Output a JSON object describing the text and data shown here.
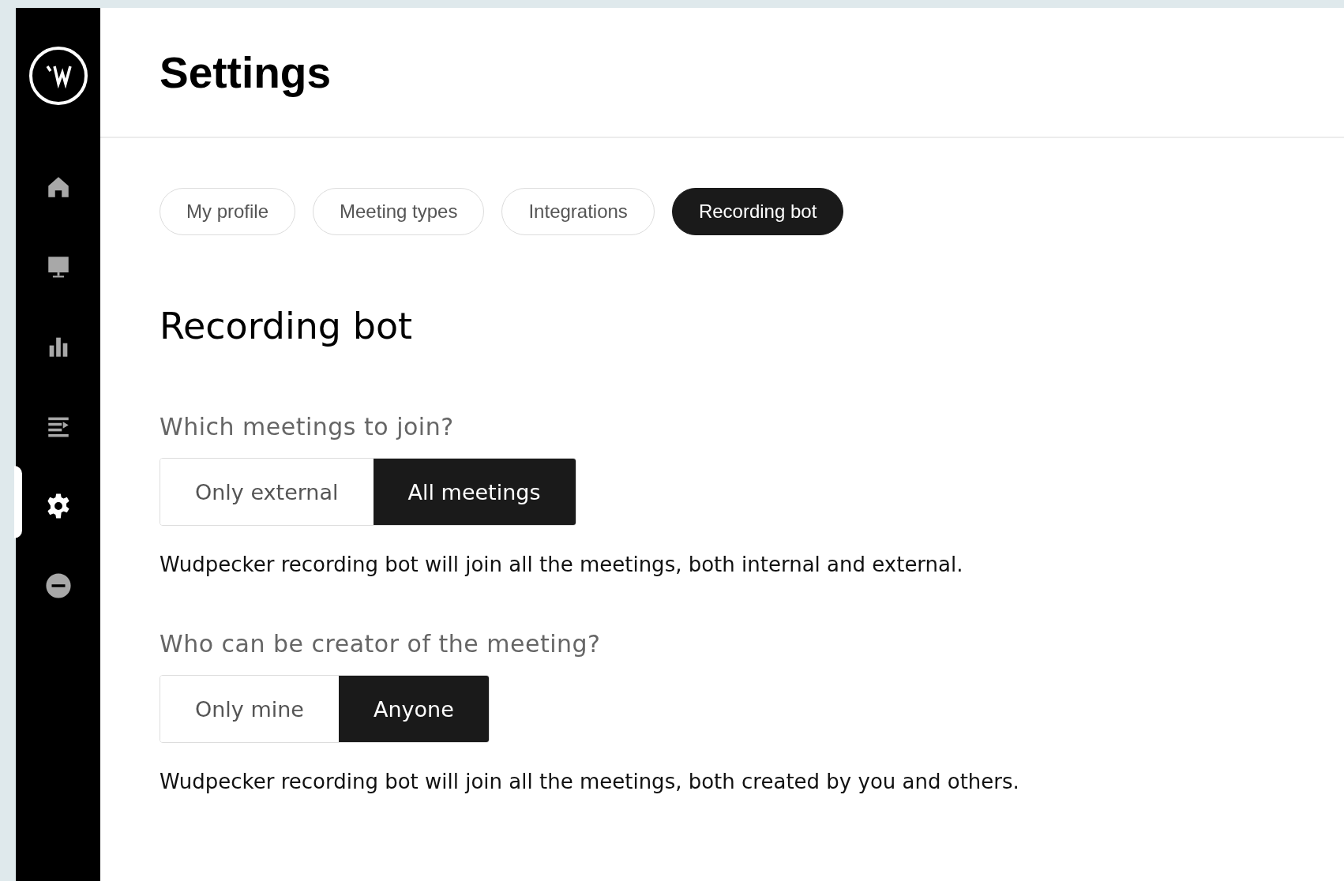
{
  "sidebar": {
    "items": [
      {
        "kind": "home",
        "selected": false
      },
      {
        "kind": "monitor",
        "selected": false
      },
      {
        "kind": "chart",
        "selected": false
      },
      {
        "kind": "list",
        "selected": false
      },
      {
        "kind": "settings",
        "selected": true
      },
      {
        "kind": "minus",
        "selected": false
      }
    ]
  },
  "header": {
    "title": "Settings"
  },
  "tabs": [
    {
      "label": "My profile",
      "selected": false
    },
    {
      "label": "Meeting types",
      "selected": false
    },
    {
      "label": "Integrations",
      "selected": false
    },
    {
      "label": "Recording bot",
      "selected": true
    }
  ],
  "section": {
    "title": "Recording bot",
    "questions": [
      {
        "label": "Which meetings to join?",
        "options": [
          {
            "label": "Only external",
            "selected": false
          },
          {
            "label": "All meetings",
            "selected": true
          }
        ],
        "description": "Wudpecker recording bot will join all the meetings, both internal and external."
      },
      {
        "label": "Who can be creator of the meeting?",
        "options": [
          {
            "label": "Only mine",
            "selected": false
          },
          {
            "label": "Anyone",
            "selected": true
          }
        ],
        "description": "Wudpecker recording bot will join all the meetings, both created by you and others."
      }
    ]
  }
}
